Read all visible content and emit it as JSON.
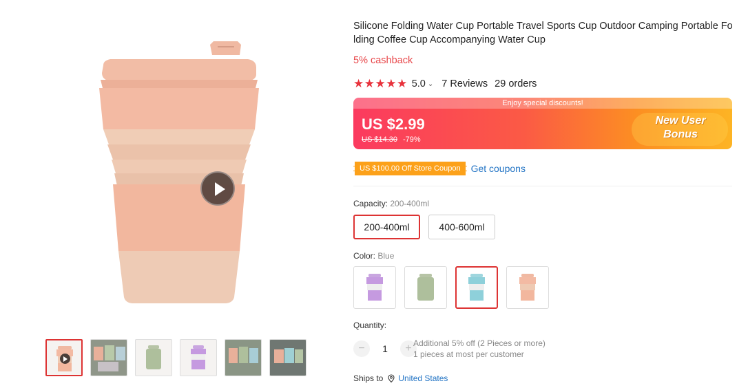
{
  "product": {
    "title": "Silicone Folding Water Cup Portable Travel Sports Cup Outdoor Camping Portable Folding Coffee Cup Accompanying Water Cup",
    "cashback": "5% cashback",
    "rating": "5.0",
    "reviews": "7 Reviews",
    "orders": "29 orders"
  },
  "banner": {
    "top_text": "Enjoy special discounts!",
    "price": "US $2.99",
    "old_price": "US $14.30",
    "discount": "-79%",
    "bonus_line1": "New User",
    "bonus_line2": "Bonus"
  },
  "coupon": {
    "label": "US $100.00 Off Store Coupon",
    "action": "Get coupons"
  },
  "capacity": {
    "label": "Capacity:",
    "selected": "200-400ml",
    "options": [
      "200-400ml",
      "400-600ml"
    ]
  },
  "color": {
    "label": "Color:",
    "selected": "Blue",
    "swatches": [
      "purple",
      "green",
      "blue",
      "pink"
    ]
  },
  "quantity": {
    "label": "Quantity:",
    "minus": "−",
    "value": "1",
    "plus": "+",
    "info1": "Additional 5% off (2 Pieces or more)",
    "info2": "1 pieces at most per customer"
  },
  "shipping": {
    "label": "Ships to",
    "location": "United States"
  },
  "colors": {
    "accent": "#e8323c",
    "link": "#2475c5",
    "cup_pink": "#f0b9a2",
    "cup_beige": "#ecc9b1"
  }
}
